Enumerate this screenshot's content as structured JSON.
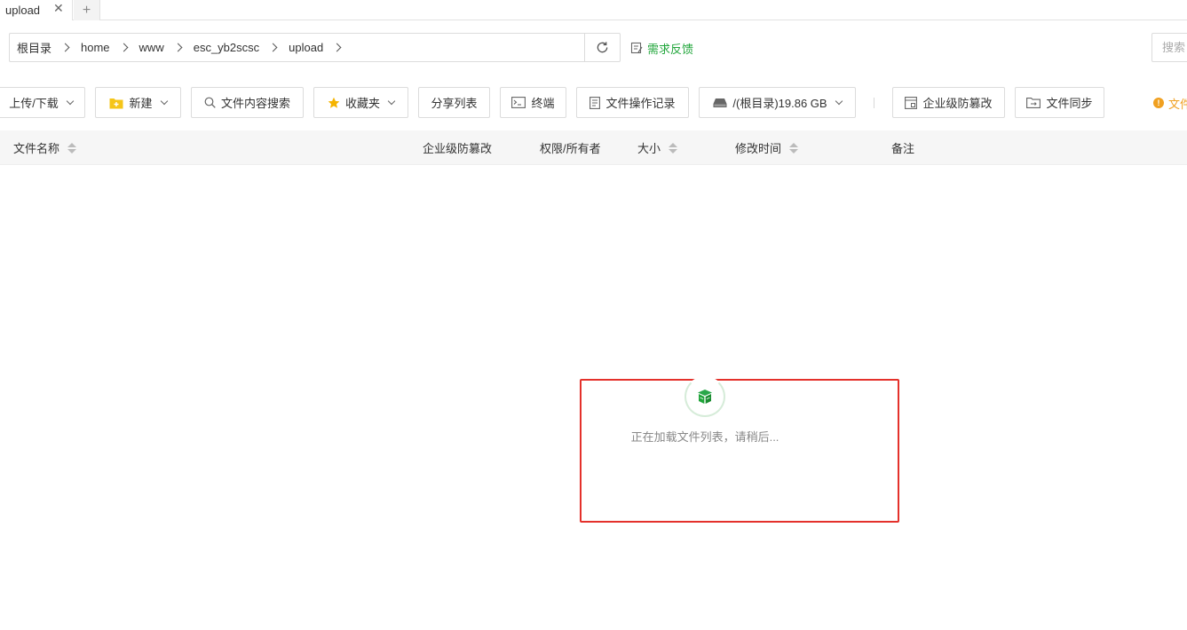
{
  "tabs": [
    {
      "label": "upload"
    }
  ],
  "tab_add_symbol": "+",
  "tab_close_symbol": "✕",
  "breadcrumb": [
    "根目录",
    "home",
    "www",
    "esc_yb2scsc",
    "upload"
  ],
  "feedback_label": "需求反馈",
  "search_placeholder": "搜索",
  "toolbar": {
    "upload_download": "上传/下载",
    "new": "新建",
    "content_search": "文件内容搜索",
    "favorites": "收藏夹",
    "share_list": "分享列表",
    "terminal": "终端",
    "operation_log": "文件操作记录",
    "disk": "/(根目录)19.86 GB",
    "tamper_proof": "企业级防篡改",
    "file_sync": "文件同步",
    "notice": "文件"
  },
  "table_headers": {
    "name": "文件名称",
    "tamper": "企业级防篡改",
    "perm_owner": "权限/所有者",
    "size": "大小",
    "mtime": "修改时间",
    "remark": "备注"
  },
  "loading_text": "正在加载文件列表，请稍后...",
  "colors": {
    "accent": "#20a53a",
    "warning": "#f0a020",
    "highlight": "#e4312b"
  }
}
